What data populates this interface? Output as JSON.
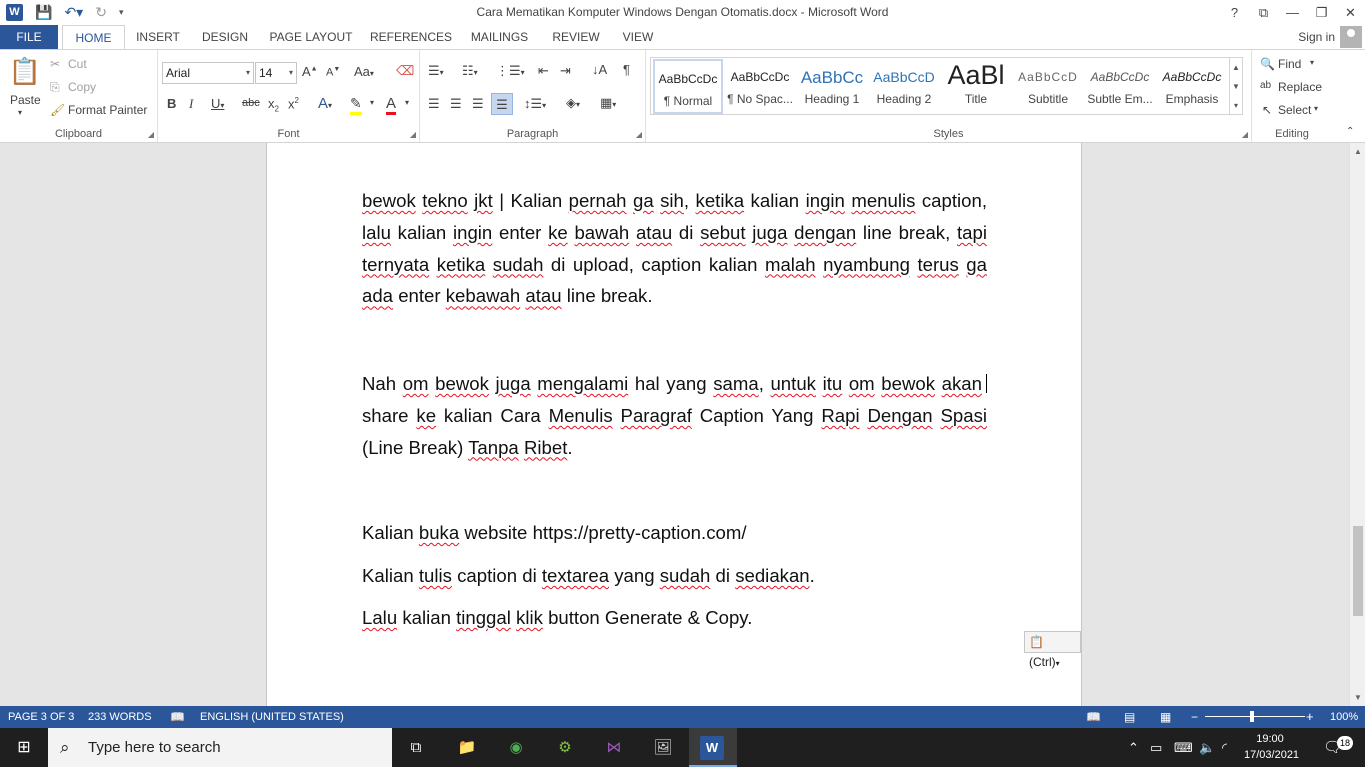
{
  "window": {
    "title": "Cara Mematikan Komputer Windows Dengan Otomatis.docx - Microsoft Word",
    "logo": "W",
    "controls": [
      "?",
      "⧉",
      "—",
      "❐",
      "✕"
    ]
  },
  "tabs": [
    "FILE",
    "HOME",
    "INSERT",
    "DESIGN",
    "PAGE LAYOUT",
    "REFERENCES",
    "MAILINGS",
    "REVIEW",
    "VIEW"
  ],
  "active_tab": "HOME",
  "signin": "Sign in",
  "ribbon": {
    "clipboard": {
      "paste": "Paste",
      "cut": "Cut",
      "copy": "Copy",
      "format_painter": "Format Painter",
      "label": "Clipboard"
    },
    "font": {
      "name": "Arial",
      "size": "14",
      "label": "Font"
    },
    "paragraph": {
      "label": "Paragraph"
    },
    "styles": {
      "label": "Styles",
      "items": [
        {
          "preview": "AaBbCcDc",
          "name": "¶ Normal"
        },
        {
          "preview": "AaBbCcDc",
          "name": "¶ No Spac..."
        },
        {
          "preview": "AaBbCc",
          "name": "Heading 1"
        },
        {
          "preview": "AaBbCcD",
          "name": "Heading 2"
        },
        {
          "preview": "AaBl",
          "name": "Title"
        },
        {
          "preview": "AaBbCcD",
          "name": "Subtitle"
        },
        {
          "preview": "AaBbCcDc",
          "name": "Subtle Em..."
        },
        {
          "preview": "AaBbCcDc",
          "name": "Emphasis"
        }
      ]
    },
    "editing": {
      "find": "Find",
      "replace": "Replace",
      "select": "Select",
      "label": "Editing"
    }
  },
  "document": {
    "para1_pieces": [
      {
        "t": "bewok",
        "s": true
      },
      {
        "t": " "
      },
      {
        "t": "tekno",
        "s": true
      },
      {
        "t": " "
      },
      {
        "t": "jkt",
        "s": true
      },
      {
        "t": " | Kalian "
      },
      {
        "t": "pernah",
        "s": true
      },
      {
        "t": " "
      },
      {
        "t": "ga",
        "s": true
      },
      {
        "t": " "
      },
      {
        "t": "sih",
        "s": true
      },
      {
        "t": ", "
      },
      {
        "t": "ketika",
        "s": true
      },
      {
        "t": " kalian "
      },
      {
        "t": "ingin",
        "s": true
      },
      {
        "t": " "
      },
      {
        "t": "menulis",
        "s": true
      },
      {
        "t": " caption, "
      },
      {
        "t": "lalu",
        "s": true
      },
      {
        "t": " kalian "
      },
      {
        "t": "ingin",
        "s": true
      },
      {
        "t": " enter "
      },
      {
        "t": "ke",
        "s": true
      },
      {
        "t": " "
      },
      {
        "t": "bawah",
        "s": true
      },
      {
        "t": " "
      },
      {
        "t": "atau",
        "s": true
      },
      {
        "t": " di "
      },
      {
        "t": "sebut",
        "s": true
      },
      {
        "t": " "
      },
      {
        "t": "juga",
        "s": true
      },
      {
        "t": " "
      },
      {
        "t": "dengan",
        "s": true
      },
      {
        "t": " line break, "
      },
      {
        "t": "tapi",
        "s": true
      },
      {
        "t": " "
      },
      {
        "t": "ternyata",
        "s": true
      },
      {
        "t": " "
      },
      {
        "t": "ketika",
        "s": true
      },
      {
        "t": " "
      },
      {
        "t": "sudah",
        "s": true
      },
      {
        "t": " di upload, caption kalian "
      },
      {
        "t": "malah",
        "s": true
      },
      {
        "t": " "
      },
      {
        "t": "nyambung",
        "s": true
      },
      {
        "t": " "
      },
      {
        "t": "terus",
        "s": true
      },
      {
        "t": " "
      },
      {
        "t": "ga",
        "s": true
      },
      {
        "t": " "
      },
      {
        "t": "ada",
        "s": true
      },
      {
        "t": " enter "
      },
      {
        "t": "kebawah",
        "s": true
      },
      {
        "t": " "
      },
      {
        "t": "atau",
        "s": true
      },
      {
        "t": " line break."
      }
    ],
    "para2_pieces": [
      {
        "t": "Nah "
      },
      {
        "t": "om",
        "s": true
      },
      {
        "t": " "
      },
      {
        "t": "bewok",
        "s": true
      },
      {
        "t": " "
      },
      {
        "t": "juga",
        "s": true
      },
      {
        "t": " "
      },
      {
        "t": "mengalami",
        "s": true
      },
      {
        "t": " hal yang "
      },
      {
        "t": "sama",
        "s": true
      },
      {
        "t": ", "
      },
      {
        "t": "untuk",
        "s": true
      },
      {
        "t": " "
      },
      {
        "t": "itu",
        "s": true
      },
      {
        "t": " "
      },
      {
        "t": "om",
        "s": true
      },
      {
        "t": " "
      },
      {
        "t": "bewok",
        "s": true
      },
      {
        "t": " "
      },
      {
        "t": "akan",
        "s": true
      },
      {
        "t": " share "
      },
      {
        "t": "ke",
        "s": true
      },
      {
        "t": " kalian Cara "
      },
      {
        "t": "Menulis",
        "s": true
      },
      {
        "t": " "
      },
      {
        "t": "Paragraf",
        "s": true
      },
      {
        "t": " Caption Yang "
      },
      {
        "t": "Rapi",
        "s": true
      },
      {
        "t": " "
      },
      {
        "t": "Dengan",
        "s": true
      },
      {
        "t": " "
      },
      {
        "t": "Spasi",
        "s": true
      },
      {
        "t": " (Line Break) "
      },
      {
        "t": "Tanpa",
        "s": true
      },
      {
        "t": " "
      },
      {
        "t": "Ribet",
        "s": true
      },
      {
        "t": "."
      }
    ],
    "para3_pieces": [
      {
        "t": "Kalian "
      },
      {
        "t": "buka",
        "s": true
      },
      {
        "t": " website https://pretty-caption.com/"
      }
    ],
    "para4_pieces": [
      {
        "t": "Kalian "
      },
      {
        "t": "tulis",
        "s": true
      },
      {
        "t": " caption di "
      },
      {
        "t": "textarea",
        "s": true
      },
      {
        "t": " yang "
      },
      {
        "t": "sudah",
        "s": true
      },
      {
        "t": " di "
      },
      {
        "t": "sediakan",
        "s": true
      },
      {
        "t": "."
      }
    ],
    "para5_pieces": [
      {
        "t": "Lalu",
        "s": true
      },
      {
        "t": " kalian "
      },
      {
        "t": "tinggal",
        "s": true
      },
      {
        "t": " "
      },
      {
        "t": "klik",
        "s": true
      },
      {
        "t": " button Generate & Copy."
      }
    ],
    "paste_options": "(Ctrl)"
  },
  "status": {
    "page": "PAGE 3 OF 3",
    "words": "233 WORDS",
    "language": "ENGLISH (UNITED STATES)",
    "zoom": "100%",
    "zoom_level_percent": 100
  },
  "taskbar": {
    "search_placeholder": "Type here to search",
    "time": "19:00",
    "date": "17/03/2021",
    "notifications": "18"
  }
}
